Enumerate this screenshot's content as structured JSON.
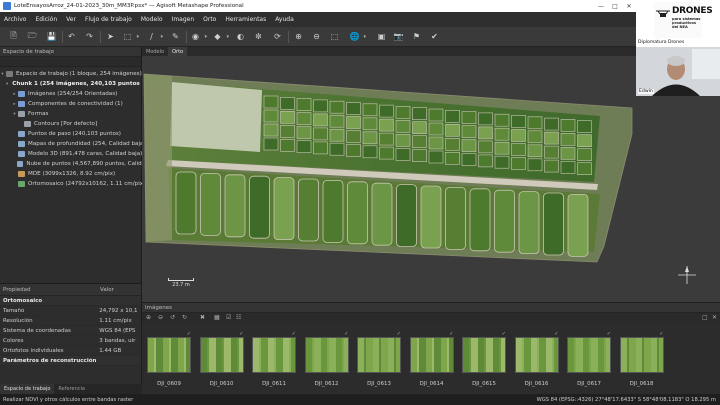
{
  "window": {
    "title": "LoteEnsayosArroz_24-01-2023_30m_MM3P.psx* — Agisoft Metashape Professional",
    "minimize": "—",
    "maximize": "□",
    "close": "✕"
  },
  "menu": [
    "Archivo",
    "Edición",
    "Ver",
    "Flujo de trabajo",
    "Modelo",
    "Imagen",
    "Orto",
    "Herramientas",
    "Ayuda"
  ],
  "toolbar_icons": [
    "new-file-icon",
    "open-folder-icon",
    "save-icon",
    "print-icon",
    "undo-icon",
    "redo-icon",
    "navigation-icon",
    "rectangle-select-icon",
    "polyline-icon",
    "ruler-icon",
    "brush-icon",
    "contrast-icon",
    "color-wheel-icon",
    "rotate-icon",
    "zoom-in-icon",
    "zoom-out-icon",
    "reset-view-icon",
    "globe-icon",
    "fullscreen-icon",
    "camera-icon",
    "cursor-pin-icon"
  ],
  "workspace": {
    "header": "Espacio de trabajo",
    "root": "Espacio de trabajo (1 bloque, 254 imágenes)",
    "items": [
      {
        "label": "Chunk 1 (254 imágenes, 240,103 puntos de pa",
        "level": 1,
        "bold": true,
        "color": "#5a8fd6"
      },
      {
        "label": "Imágenes (254/254 Orientadas)",
        "level": 2,
        "bold": false,
        "color": "#7b9bd4"
      },
      {
        "label": "Componentes de conectividad (1)",
        "level": 2,
        "bold": false,
        "color": "#7b9bd4"
      },
      {
        "label": "Formas",
        "level": 2,
        "bold": false,
        "color": "#9aa0a8"
      },
      {
        "label": "Contours [Por defecto]",
        "level": 3,
        "bold": false,
        "color": "#9aa0a8"
      },
      {
        "label": "Puntos de paso (240,103 puntos)",
        "level": 2,
        "bold": false,
        "color": "#8aa6c8"
      },
      {
        "label": "Mapas de profundidad (254, Calidad baja, Fil",
        "level": 2,
        "bold": false,
        "color": "#8aa6c8"
      },
      {
        "label": "Modelo 3D (891,478 caras, Calidad baja)",
        "level": 2,
        "bold": false,
        "color": "#8aa6c8"
      },
      {
        "label": "Nube de puntos (4,567,890 puntos, Calidad b",
        "level": 2,
        "bold": false,
        "color": "#8aa6c8"
      },
      {
        "label": "MDE (3099x1326, 8.92 cm/pix)",
        "level": 2,
        "bold": false,
        "color": "#c89a5a"
      },
      {
        "label": "Ortomosaico (24792x10162, 1.11 cm/pix)",
        "level": 2,
        "bold": false,
        "color": "#6aa86a"
      }
    ]
  },
  "properties": {
    "col_property": "Propiedad",
    "col_value": "Valor",
    "rows": [
      {
        "key": "Ortomosaico",
        "value": "",
        "section": true
      },
      {
        "key": "Tamaño",
        "value": "24,792 x 10,1",
        "section": false
      },
      {
        "key": "Resolución",
        "value": "1.11 cm/pix",
        "section": false
      },
      {
        "key": "Sistema de coordenadas",
        "value": "WGS 84 (EPS",
        "section": false
      },
      {
        "key": "Colores",
        "value": "3 bandas, uir",
        "section": false
      },
      {
        "key": "Ortofotos individuales",
        "value": "1.44 GB",
        "section": false
      },
      {
        "key": "Parámetros de reconstrucción",
        "value": "",
        "section": true
      }
    ]
  },
  "bottom_tabs": [
    {
      "label": "Espacio de trabajo",
      "active": true
    },
    {
      "label": "Referencia",
      "active": false
    }
  ],
  "view_tabs": [
    {
      "label": "Modelo",
      "active": false
    },
    {
      "label": "Orto",
      "active": true
    }
  ],
  "ortho": {
    "scale_label": "23.7 m"
  },
  "photos_panel": {
    "header": "Imágenes",
    "thumbnails": [
      "DJI_0609",
      "DJI_0610",
      "DJI_0611",
      "DJI_0612",
      "DJI_0613",
      "DJI_0614",
      "DJI_0615",
      "DJI_0616",
      "DJI_0617",
      "DJI_0618"
    ]
  },
  "status": {
    "left": "Realizar NDVI y otros cálculos entre bandas raster",
    "right": "WGS 84 (EPSG::4326)   27°48'17.6433\" S   58°48'08.1183\" O   18.295 m"
  },
  "webcam": {
    "brand_big": "DRONES",
    "brand_sub": "para sistemas productivos del NEA",
    "course": "Diplomatura Drones",
    "name": "Edwin"
  },
  "colors": {
    "app_bg": "#2b2b2b",
    "viewport_bg": "#3b3b3b",
    "accent": "#5a8fd6",
    "field_green": "#4f7a32"
  }
}
